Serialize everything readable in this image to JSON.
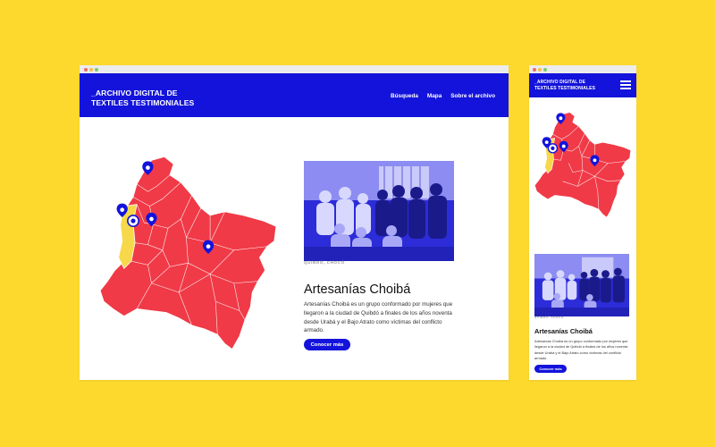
{
  "site": {
    "brand_line1": "_ARCHIVO DIGITAL DE",
    "brand_line2": "TEXTILES TESTIMONIALES",
    "nav": [
      "Búsqueda",
      "Mapa",
      "Sobre el archivo"
    ]
  },
  "feature": {
    "kicker": "QUIBDÓ, CHOCÓ",
    "title": "Artesanías Choibá",
    "description": "Artesanías Choibá es un grupo conformado por mujeres que llegaron a la ciudad de Quibdó a finales de los años noventa desde Urabá y el Bajo Atrato como víctimas del conflicto armado.",
    "button": "Conocer más"
  },
  "colors": {
    "background": "#FDD92E",
    "header": "#1313DB",
    "map_fill": "#F03A47",
    "map_highlight": "#F7D84A",
    "photo_tint": "#2C2CD8"
  },
  "icons": {
    "menu": "hamburger-icon",
    "marker": "map-pin-icon"
  }
}
